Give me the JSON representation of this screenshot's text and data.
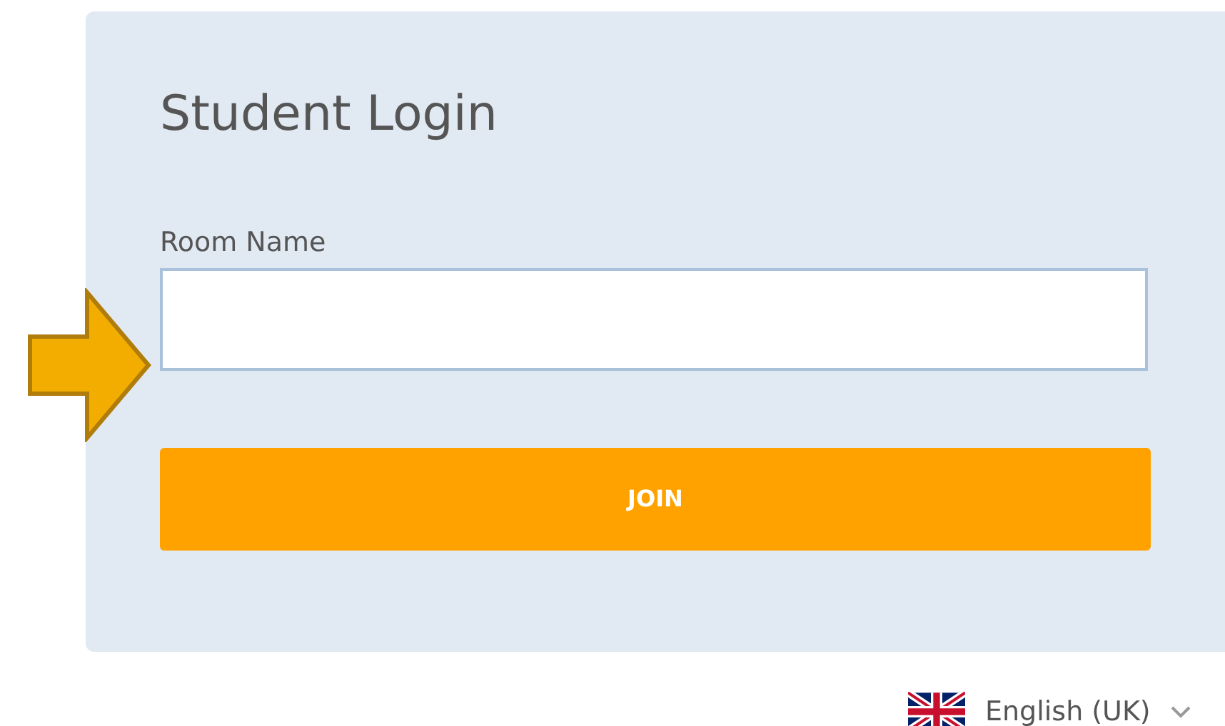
{
  "login": {
    "title": "Student Login",
    "field": {
      "label": "Room Name"
    },
    "button": {
      "label": "JOIN"
    }
  },
  "language": {
    "label": "English (UK)"
  }
}
